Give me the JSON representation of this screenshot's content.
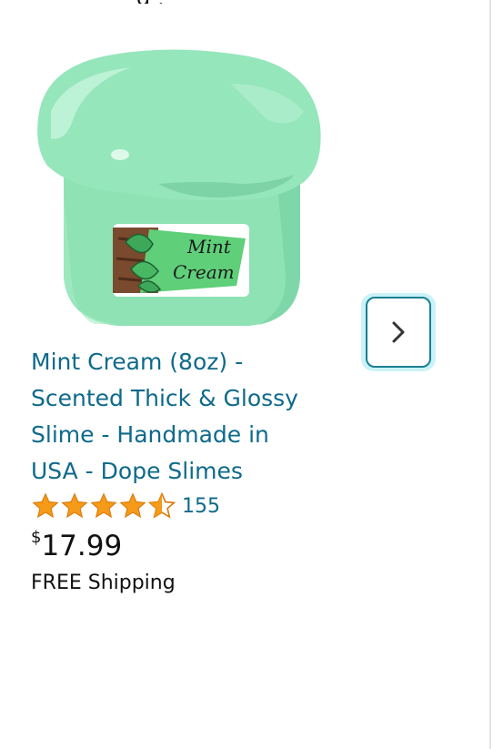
{
  "product": {
    "title": "Mint Cream (8oz) - Scented Thick & Glossy Slime - Handmade in USA - Dope Slimes",
    "rating": 4.5,
    "rating_count": "155",
    "price_symbol": "$",
    "price_value": "17.99",
    "shipping": "FREE Shipping",
    "image": {
      "label_line1": "Mint",
      "label_line2": "Cream",
      "colors": {
        "slime": "#8fe3b6",
        "label_green": "#5fcf7a",
        "wood": "#7a4a2e"
      }
    }
  },
  "carousel": {
    "next_icon": "chevron-right-icon"
  },
  "colors": {
    "link": "#0e6a8a",
    "star": "#f59a19",
    "focus_ring": "#c9f3f8"
  }
}
